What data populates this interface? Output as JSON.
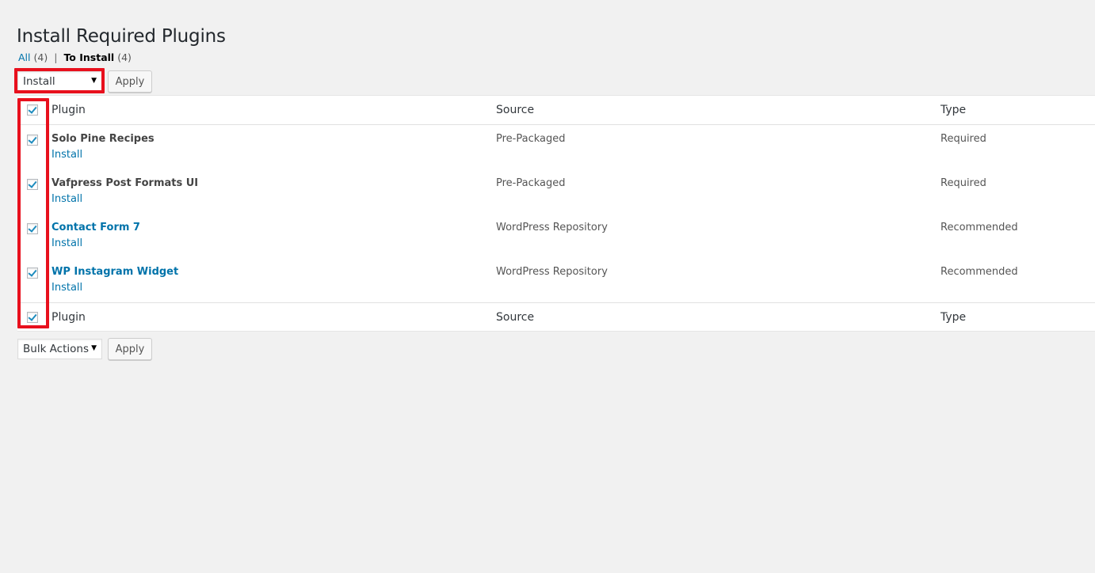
{
  "page": {
    "title": "Install Required Plugins"
  },
  "filters": {
    "all_label": "All",
    "all_count": "(4)",
    "separator": "|",
    "to_install_label": "To Install",
    "to_install_count": "(4)"
  },
  "top_actions": {
    "selected": "Install",
    "apply_label": "Apply"
  },
  "bottom_actions": {
    "selected": "Bulk Actions",
    "apply_label": "Apply"
  },
  "table": {
    "columns": {
      "plugin": "Plugin",
      "source": "Source",
      "type": "Type"
    },
    "rows": [
      {
        "name": "Solo Pine Recipes",
        "action": "Install",
        "source": "Pre-Packaged",
        "type": "Required",
        "checked": true
      },
      {
        "name": "Vafpress Post Formats UI",
        "action": "Install",
        "source": "Pre-Packaged",
        "type": "Required",
        "checked": true
      },
      {
        "name": "Contact Form 7",
        "action": "Install",
        "source": "WordPress Repository",
        "type": "Recommended",
        "checked": true
      },
      {
        "name": "WP Instagram Widget",
        "action": "Install",
        "source": "WordPress Repository",
        "type": "Recommended",
        "checked": true
      }
    ]
  },
  "colors": {
    "link": "#0073aa",
    "highlight": "#e8101d",
    "check": "#1e8cbe"
  },
  "icons": {
    "dropdown": "chevron-down-icon",
    "checkbox": "checkmark-icon"
  }
}
